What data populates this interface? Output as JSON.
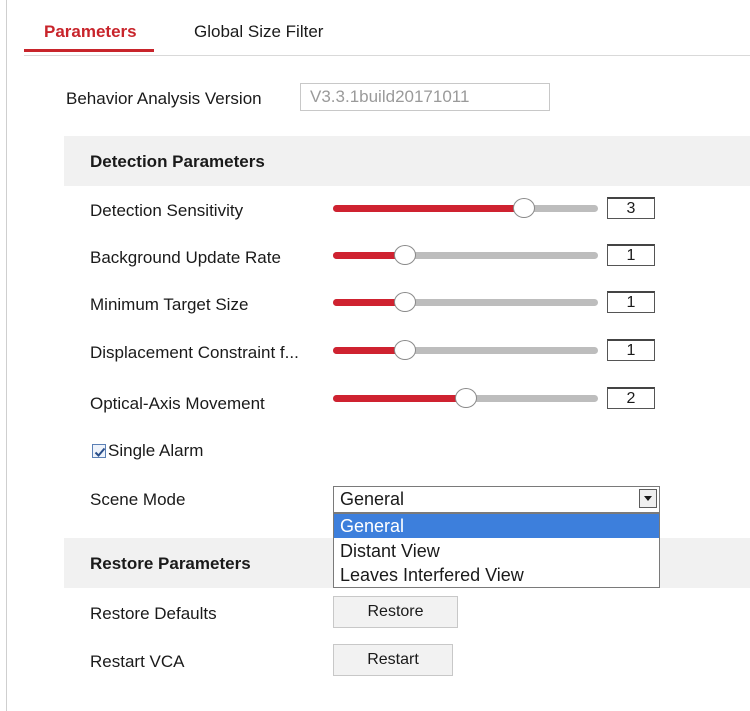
{
  "tabs": [
    {
      "label": "Parameters",
      "active": true
    },
    {
      "label": "Global Size Filter",
      "active": false
    }
  ],
  "version": {
    "label": "Behavior Analysis Version",
    "value": "V3.3.1build20171011"
  },
  "detection": {
    "title": "Detection Parameters",
    "sliders": [
      {
        "label": "Detection Sensitivity",
        "value": "3",
        "level": 0.72
      },
      {
        "label": "Background Update Rate",
        "value": "1",
        "level": 0.27
      },
      {
        "label": "Minimum Target Size",
        "value": "1",
        "level": 0.27
      },
      {
        "label": "Displacement Constraint f...",
        "value": "1",
        "level": 0.27
      },
      {
        "label": "Optical-Axis Movement",
        "value": "2",
        "level": 0.5
      }
    ],
    "single_alarm": {
      "label": "Single Alarm",
      "checked": true
    },
    "scene_mode": {
      "label": "Scene Mode",
      "value": "General",
      "options": [
        "General",
        "Distant View",
        "Leaves Interfered View"
      ]
    }
  },
  "restore": {
    "title": "Restore Parameters",
    "defaults_label": "Restore Defaults",
    "restore_button": "Restore",
    "restart_label": "Restart VCA",
    "restart_button": "Restart"
  },
  "colors": {
    "accent": "#c8242b",
    "slider_fill": "#cf2230",
    "selected_option": "#3d7fdc"
  }
}
